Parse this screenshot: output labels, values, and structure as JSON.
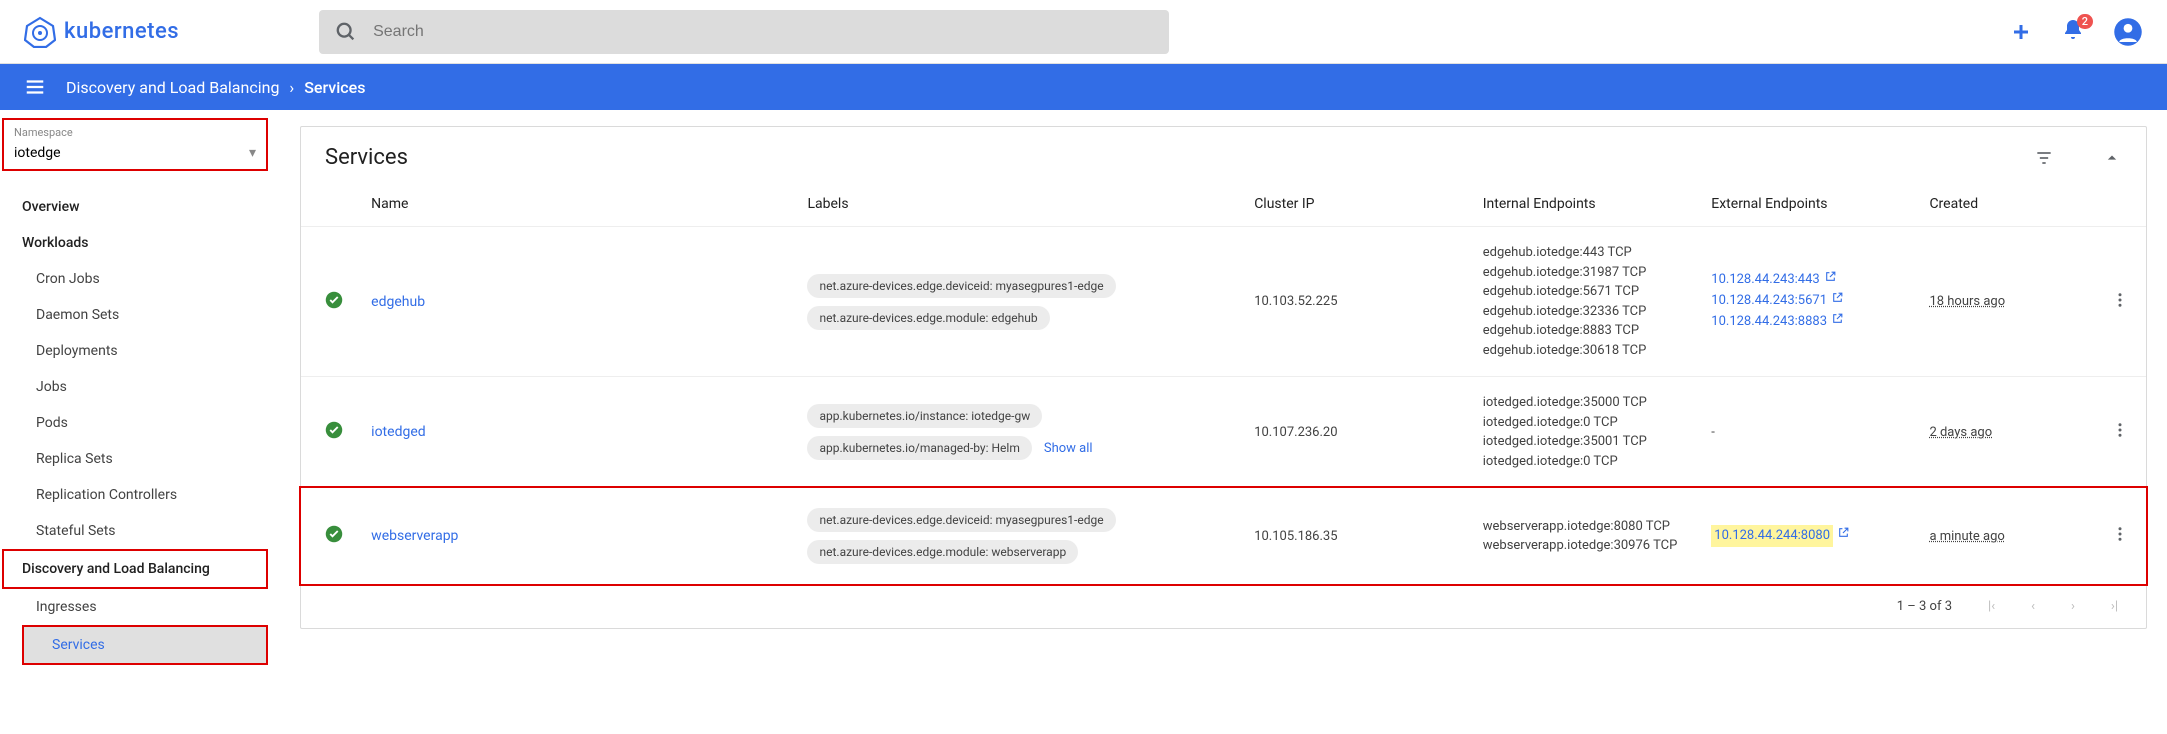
{
  "header": {
    "logo_text": "kubernetes",
    "search_placeholder": "Search",
    "notification_count": "2"
  },
  "breadcrumb": {
    "parent": "Discovery and Load Balancing",
    "current": "Services"
  },
  "namespace": {
    "label": "Namespace",
    "value": "iotedge"
  },
  "sidebar": {
    "overview": "Overview",
    "workloads": "Workloads",
    "cron_jobs": "Cron Jobs",
    "daemon_sets": "Daemon Sets",
    "deployments": "Deployments",
    "jobs": "Jobs",
    "pods": "Pods",
    "replica_sets": "Replica Sets",
    "replication_controllers": "Replication Controllers",
    "stateful_sets": "Stateful Sets",
    "dlb": "Discovery and Load Balancing",
    "ingresses": "Ingresses",
    "services": "Services"
  },
  "table": {
    "title": "Services",
    "columns": {
      "name": "Name",
      "labels": "Labels",
      "cluster_ip": "Cluster IP",
      "internal": "Internal Endpoints",
      "external": "External Endpoints",
      "created": "Created"
    },
    "show_all": "Show all",
    "rows": [
      {
        "name": "edgehub",
        "labels": [
          "net.azure-devices.edge.deviceid: myasegpures1-edge",
          "net.azure-devices.edge.module: edgehub"
        ],
        "cluster_ip": "10.103.52.225",
        "internal": [
          "edgehub.iotedge:443 TCP",
          "edgehub.iotedge:31987 TCP",
          "edgehub.iotedge:5671 TCP",
          "edgehub.iotedge:32336 TCP",
          "edgehub.iotedge:8883 TCP",
          "edgehub.iotedge:30618 TCP"
        ],
        "external": [
          "10.128.44.243:443",
          "10.128.44.243:5671",
          "10.128.44.243:8883"
        ],
        "created": "18 hours ago"
      },
      {
        "name": "iotedged",
        "labels": [
          "app.kubernetes.io/instance: iotedge-gw",
          "app.kubernetes.io/managed-by: Helm"
        ],
        "labels_more": true,
        "cluster_ip": "10.107.236.20",
        "internal": [
          "iotedged.iotedge:35000 TCP",
          "iotedged.iotedge:0 TCP",
          "iotedged.iotedge:35001 TCP",
          "iotedged.iotedge:0 TCP"
        ],
        "external": [],
        "created": "2 days ago"
      },
      {
        "name": "webserverapp",
        "labels": [
          "net.azure-devices.edge.deviceid: myasegpures1-edge",
          "net.azure-devices.edge.module: webserverapp"
        ],
        "cluster_ip": "10.105.186.35",
        "internal": [
          "webserverapp.iotedge:8080 TCP",
          "webserverapp.iotedge:30976 TCP"
        ],
        "external": [
          "10.128.44.244:8080"
        ],
        "created": "a minute ago",
        "highlight_row": true,
        "highlight_ext": true
      }
    ],
    "pagination": "1 – 3 of 3"
  }
}
